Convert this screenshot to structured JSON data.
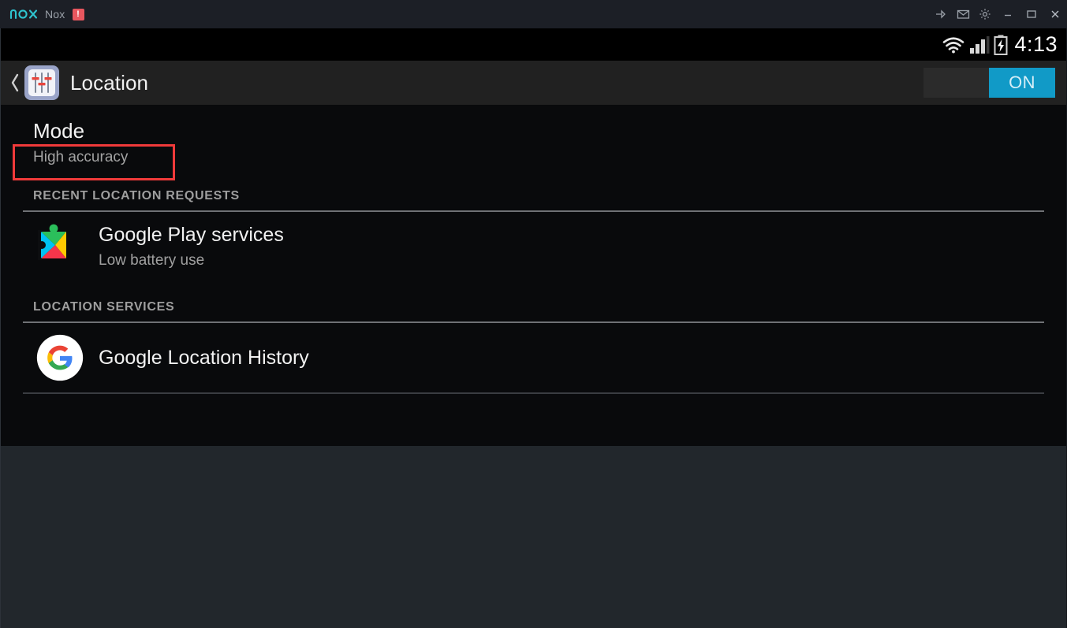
{
  "window": {
    "app_name": "Nox",
    "badge": "!",
    "controls": [
      {
        "name": "pin-icon",
        "label": "Pin"
      },
      {
        "name": "mail-icon",
        "label": "Messages"
      },
      {
        "name": "gear-icon",
        "label": "Settings"
      },
      {
        "name": "minimize-icon",
        "label": "Minimize"
      },
      {
        "name": "maximize-icon",
        "label": "Maximize"
      },
      {
        "name": "close-icon",
        "label": "Close"
      }
    ]
  },
  "status_bar": {
    "time": "4:13",
    "icons": [
      "wifi-icon",
      "signal-icon",
      "battery-charging-icon"
    ]
  },
  "action_bar": {
    "title": "Location",
    "back_caret": "‹",
    "app_icon": "settings-sliders-icon",
    "toggle": {
      "label": "ON",
      "state": "on",
      "accent_color": "#119ac7"
    }
  },
  "content": {
    "mode": {
      "title": "Mode",
      "value": "High accuracy"
    },
    "sections": [
      {
        "header": "RECENT LOCATION REQUESTS",
        "rows": [
          {
            "icon": "google-play-services-icon",
            "title": "Google Play services",
            "subtitle": "Low battery use"
          }
        ]
      },
      {
        "header": "LOCATION SERVICES",
        "rows": [
          {
            "icon": "google-g-icon",
            "title": "Google Location History",
            "subtitle": ""
          }
        ]
      }
    ]
  },
  "annotation": {
    "color": "#f03a3a",
    "target": "High accuracy"
  }
}
